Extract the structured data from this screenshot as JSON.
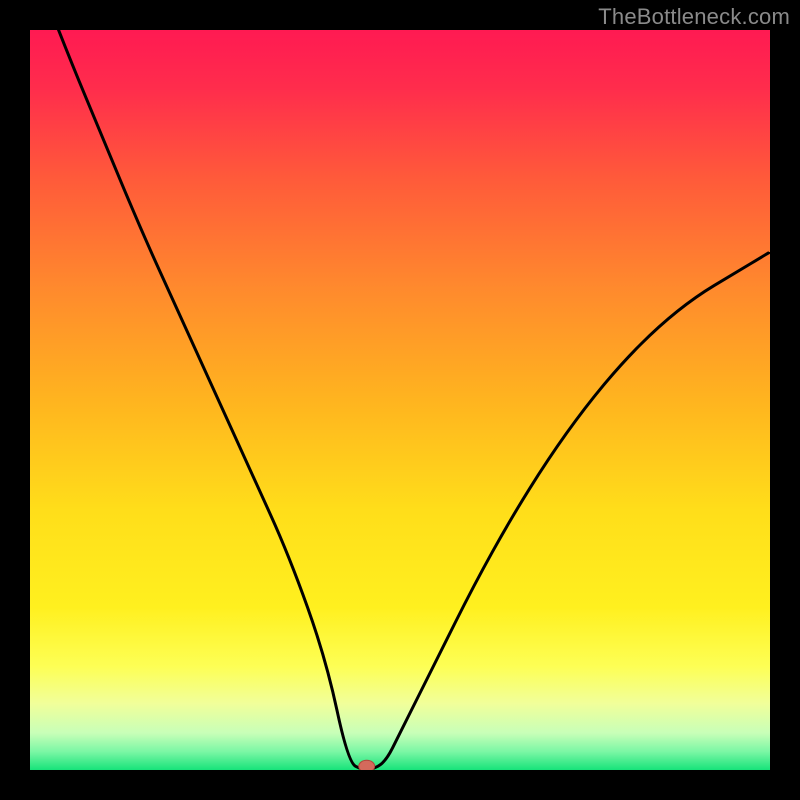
{
  "watermark": "TheBottleneck.com",
  "chart_data": {
    "type": "line",
    "title": "",
    "xlabel": "",
    "ylabel": "",
    "xlim": [
      0,
      1
    ],
    "ylim": [
      0,
      1
    ],
    "series": [
      {
        "name": "curve",
        "x": [
          0.0,
          0.05,
          0.1,
          0.15,
          0.2,
          0.25,
          0.3,
          0.35,
          0.4,
          0.43,
          0.45,
          0.46,
          0.48,
          0.5,
          0.55,
          0.6,
          0.65,
          0.7,
          0.75,
          0.8,
          0.85,
          0.9,
          0.95,
          1.0
        ],
        "y": [
          1.1,
          0.97,
          0.85,
          0.73,
          0.62,
          0.51,
          0.4,
          0.29,
          0.15,
          0.01,
          0.0,
          0.0,
          0.01,
          0.05,
          0.15,
          0.25,
          0.34,
          0.42,
          0.49,
          0.55,
          0.6,
          0.64,
          0.67,
          0.7
        ]
      }
    ],
    "marker": {
      "x": 0.455,
      "y": 0.005
    },
    "gradient_stops": [
      {
        "offset": 0.0,
        "color": "#ff1a52"
      },
      {
        "offset": 0.08,
        "color": "#ff2d4c"
      },
      {
        "offset": 0.2,
        "color": "#ff5a3a"
      },
      {
        "offset": 0.35,
        "color": "#ff8a2d"
      },
      {
        "offset": 0.5,
        "color": "#ffb41f"
      },
      {
        "offset": 0.65,
        "color": "#ffde1a"
      },
      {
        "offset": 0.78,
        "color": "#fff01f"
      },
      {
        "offset": 0.86,
        "color": "#fdff55"
      },
      {
        "offset": 0.91,
        "color": "#f1ff9a"
      },
      {
        "offset": 0.95,
        "color": "#c8ffb8"
      },
      {
        "offset": 0.975,
        "color": "#7cf7a5"
      },
      {
        "offset": 1.0,
        "color": "#17e37a"
      }
    ],
    "colors": {
      "curve_stroke": "#000000",
      "marker_fill": "#d46a5c",
      "marker_stroke": "#b2463a",
      "frame": "#000000"
    }
  }
}
